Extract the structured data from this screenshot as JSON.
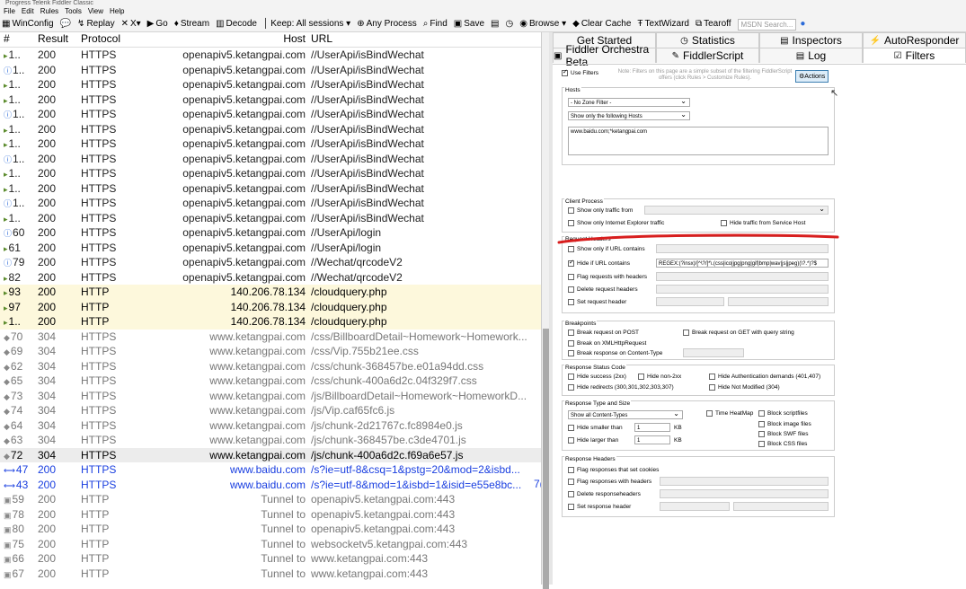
{
  "window": {
    "title": "Progress Telerik Fiddler Classic"
  },
  "menu": [
    "File",
    "Edit",
    "Rules",
    "Tools",
    "View",
    "Help"
  ],
  "toolbar": [
    {
      "icon": "winconfig-icon",
      "label": "WinConfig"
    },
    {
      "icon": "comment-icon",
      "label": ""
    },
    {
      "icon": "replay-icon",
      "label": "Replay"
    },
    {
      "icon": "remove-icon",
      "label": "X▾"
    },
    {
      "icon": "go-icon",
      "label": "Go"
    },
    {
      "icon": "stream-icon",
      "label": "Stream"
    },
    {
      "icon": "decode-icon",
      "label": "Decode"
    },
    {
      "icon": "keep-icon",
      "label": "Keep: All sessions ▾"
    },
    {
      "icon": "crosshair-icon",
      "label": "Any Process"
    },
    {
      "icon": "find-icon",
      "label": "Find"
    },
    {
      "icon": "save-icon",
      "label": "Save"
    },
    {
      "icon": "screenshot-icon",
      "label": ""
    },
    {
      "icon": "timer-icon",
      "label": ""
    },
    {
      "icon": "browse-icon",
      "label": "Browse ▾"
    },
    {
      "icon": "clear-cache-icon",
      "label": "Clear Cache"
    },
    {
      "icon": "textwizard-icon",
      "label": "TextWizard"
    },
    {
      "icon": "tearoff-icon",
      "label": "Tearoff"
    }
  ],
  "msdn_search": {
    "placeholder": "MSDN Search..."
  },
  "columns": {
    "num": "#",
    "result": "Result",
    "protocol": "Protocol",
    "host": "Host",
    "url": "URL"
  },
  "sessions": [
    {
      "num": "1..",
      "result": "200",
      "protocol": "HTTPS",
      "host": "openapiv5.ketangpai.com",
      "url": "//UserApi/isBindWechat",
      "style": "dark",
      "icon": "response-icon"
    },
    {
      "num": "1..",
      "result": "200",
      "protocol": "HTTPS",
      "host": "openapiv5.ketangpai.com",
      "url": "//UserApi/isBindWechat",
      "style": "dark",
      "icon": "info-icon"
    },
    {
      "num": "1..",
      "result": "200",
      "protocol": "HTTPS",
      "host": "openapiv5.ketangpai.com",
      "url": "//UserApi/isBindWechat",
      "style": "dark",
      "icon": "response-icon"
    },
    {
      "num": "1..",
      "result": "200",
      "protocol": "HTTPS",
      "host": "openapiv5.ketangpai.com",
      "url": "//UserApi/isBindWechat",
      "style": "dark",
      "icon": "response-icon"
    },
    {
      "num": "1..",
      "result": "200",
      "protocol": "HTTPS",
      "host": "openapiv5.ketangpai.com",
      "url": "//UserApi/isBindWechat",
      "style": "dark",
      "icon": "info-icon"
    },
    {
      "num": "1..",
      "result": "200",
      "protocol": "HTTPS",
      "host": "openapiv5.ketangpai.com",
      "url": "//UserApi/isBindWechat",
      "style": "dark",
      "icon": "response-icon"
    },
    {
      "num": "1..",
      "result": "200",
      "protocol": "HTTPS",
      "host": "openapiv5.ketangpai.com",
      "url": "//UserApi/isBindWechat",
      "style": "dark",
      "icon": "response-icon"
    },
    {
      "num": "1..",
      "result": "200",
      "protocol": "HTTPS",
      "host": "openapiv5.ketangpai.com",
      "url": "//UserApi/isBindWechat",
      "style": "dark",
      "icon": "info-icon"
    },
    {
      "num": "1..",
      "result": "200",
      "protocol": "HTTPS",
      "host": "openapiv5.ketangpai.com",
      "url": "//UserApi/isBindWechat",
      "style": "dark",
      "icon": "response-icon"
    },
    {
      "num": "1..",
      "result": "200",
      "protocol": "HTTPS",
      "host": "openapiv5.ketangpai.com",
      "url": "//UserApi/isBindWechat",
      "style": "dark",
      "icon": "response-icon"
    },
    {
      "num": "1..",
      "result": "200",
      "protocol": "HTTPS",
      "host": "openapiv5.ketangpai.com",
      "url": "//UserApi/isBindWechat",
      "style": "dark",
      "icon": "info-icon"
    },
    {
      "num": "1..",
      "result": "200",
      "protocol": "HTTPS",
      "host": "openapiv5.ketangpai.com",
      "url": "//UserApi/isBindWechat",
      "style": "dark",
      "icon": "response-icon"
    },
    {
      "num": "60",
      "result": "200",
      "protocol": "HTTPS",
      "host": "openapiv5.ketangpai.com",
      "url": "//UserApi/login",
      "style": "dark",
      "icon": "info-icon"
    },
    {
      "num": "61",
      "result": "200",
      "protocol": "HTTPS",
      "host": "openapiv5.ketangpai.com",
      "url": "//UserApi/login",
      "style": "dark",
      "icon": "response-icon"
    },
    {
      "num": "79",
      "result": "200",
      "protocol": "HTTPS",
      "host": "openapiv5.ketangpai.com",
      "url": "//Wechat/qrcodeV2",
      "style": "dark",
      "icon": "info-icon"
    },
    {
      "num": "82",
      "result": "200",
      "protocol": "HTTPS",
      "host": "openapiv5.ketangpai.com",
      "url": "//Wechat/qrcodeV2",
      "style": "dark",
      "icon": "response-icon"
    },
    {
      "num": "93",
      "result": "200",
      "protocol": "HTTP",
      "host": "140.206.78.134",
      "url": "/cloudquery.php",
      "style": "yellow",
      "icon": "response-icon"
    },
    {
      "num": "97",
      "result": "200",
      "protocol": "HTTP",
      "host": "140.206.78.134",
      "url": "/cloudquery.php",
      "style": "yellow",
      "icon": "response-icon"
    },
    {
      "num": "1..",
      "result": "200",
      "protocol": "HTTP",
      "host": "140.206.78.134",
      "url": "/cloudquery.php",
      "style": "yellow",
      "icon": "response-icon"
    },
    {
      "num": "70",
      "result": "304",
      "protocol": "HTTPS",
      "host": "www.ketangpai.com",
      "url": "/css/BillboardDetail~Homework~Homework...",
      "style": "grey",
      "icon": "cached-icon"
    },
    {
      "num": "69",
      "result": "304",
      "protocol": "HTTPS",
      "host": "www.ketangpai.com",
      "url": "/css/Vip.755b21ee.css",
      "style": "grey",
      "icon": "cached-icon"
    },
    {
      "num": "62",
      "result": "304",
      "protocol": "HTTPS",
      "host": "www.ketangpai.com",
      "url": "/css/chunk-368457be.e01a94dd.css",
      "style": "grey",
      "icon": "cached-icon"
    },
    {
      "num": "65",
      "result": "304",
      "protocol": "HTTPS",
      "host": "www.ketangpai.com",
      "url": "/css/chunk-400a6d2c.04f329f7.css",
      "style": "grey",
      "icon": "cached-icon"
    },
    {
      "num": "73",
      "result": "304",
      "protocol": "HTTPS",
      "host": "www.ketangpai.com",
      "url": "/js/BillboardDetail~Homework~HomeworkD...",
      "style": "grey",
      "icon": "cached-icon"
    },
    {
      "num": "74",
      "result": "304",
      "protocol": "HTTPS",
      "host": "www.ketangpai.com",
      "url": "/js/Vip.caf65fc6.js",
      "style": "grey",
      "icon": "cached-icon"
    },
    {
      "num": "64",
      "result": "304",
      "protocol": "HTTPS",
      "host": "www.ketangpai.com",
      "url": "/js/chunk-2d21767c.fc8984e0.js",
      "style": "grey",
      "icon": "cached-icon"
    },
    {
      "num": "63",
      "result": "304",
      "protocol": "HTTPS",
      "host": "www.ketangpai.com",
      "url": "/js/chunk-368457be.c3de4701.js",
      "style": "grey",
      "icon": "cached-icon"
    },
    {
      "num": "72",
      "result": "304",
      "protocol": "HTTPS",
      "host": "www.ketangpai.com",
      "url": "/js/chunk-400a6d2c.f69a6e57.js",
      "style": "selected",
      "icon": "cached-icon"
    },
    {
      "num": "47",
      "result": "200",
      "protocol": "HTTPS",
      "host": "www.baidu.com",
      "url": "/s?ie=utf-8&csq=1&pstg=20&mod=2&isbd...",
      "style": "blue",
      "icon": "json-icon"
    },
    {
      "num": "43",
      "result": "200",
      "protocol": "HTTPS",
      "host": "www.baidu.com",
      "url": "/s?ie=utf-8&mod=1&isbd=1&isid=e55e8bc...",
      "style": "blue",
      "icon": "json-icon"
    },
    {
      "num": "59",
      "result": "200",
      "protocol": "HTTP",
      "host": "Tunnel to",
      "url": "openapiv5.ketangpai.com:443",
      "style": "tunnel",
      "icon": "lock-icon"
    },
    {
      "num": "78",
      "result": "200",
      "protocol": "HTTP",
      "host": "Tunnel to",
      "url": "openapiv5.ketangpai.com:443",
      "style": "tunnel",
      "icon": "lock-icon"
    },
    {
      "num": "80",
      "result": "200",
      "protocol": "HTTP",
      "host": "Tunnel to",
      "url": "openapiv5.ketangpai.com:443",
      "style": "tunnel",
      "icon": "lock-icon"
    },
    {
      "num": "75",
      "result": "200",
      "protocol": "HTTP",
      "host": "Tunnel to",
      "url": "websocketv5.ketangpai.com:443",
      "style": "tunnel",
      "icon": "lock-icon"
    },
    {
      "num": "66",
      "result": "200",
      "protocol": "HTTP",
      "host": "Tunnel to",
      "url": "www.ketangpai.com:443",
      "style": "tunnel",
      "icon": "lock-icon"
    },
    {
      "num": "67",
      "result": "200",
      "protocol": "HTTP",
      "host": "Tunnel to",
      "url": "www.ketangpai.com:443",
      "style": "tunnel",
      "icon": "lock-icon"
    }
  ],
  "overflow_marker": "7(",
  "tabs_row1": [
    {
      "label": "Get Started",
      "icon": ""
    },
    {
      "label": "Statistics",
      "icon": "statistics-icon"
    },
    {
      "label": "Inspectors",
      "icon": "inspectors-icon"
    },
    {
      "label": "AutoResponder",
      "icon": "autoresponder-icon"
    }
  ],
  "tabs_row2": [
    {
      "label": "Fiddler Orchestra Beta",
      "icon": "orchestra-icon"
    },
    {
      "label": "FiddlerScript",
      "icon": "script-icon"
    },
    {
      "label": "Log",
      "icon": "log-icon"
    },
    {
      "label": "Filters",
      "icon": "filters-icon",
      "active": true
    }
  ],
  "filters": {
    "use_filters": "Use Filters",
    "note": "Note: Filters on this page are a simple subset of the filtering FiddlerScript offers (click Rules > Customize Rules).",
    "actions": "Actions",
    "hosts_title": "Hosts",
    "zone_filter": "- No Zone Filter -",
    "host_mode": "Show only the following Hosts",
    "host_list": "www.baidu.com;*ketangpai.com",
    "client_title": "Client Process",
    "show_traffic_from": "Show only traffic from",
    "ie_only": "Show only Internet Explorer traffic",
    "hide_service_host": "Hide traffic from Service Host",
    "reqh_title": "Request Headers",
    "show_if_url": "Show only if URL contains",
    "hide_if_url": "Hide if URL contains",
    "hide_if_url_value": "REGEX:(?insx)/[^\\?/]*\\.(css|ico|jpg|png|gif|bmp|wav|js|jpeg)(\\?.*)?$",
    "flag_headers": "Flag requests with headers",
    "delete_headers": "Delete request headers",
    "set_header": "Set request header",
    "bp_title": "Breakpoints",
    "bp_post": "Break request on POST",
    "bp_get": "Break request on GET with query string",
    "bp_xml": "Break on XMLHttpRequest",
    "bp_ct": "Break response on Content-Type",
    "rsc_title": "Response Status Code",
    "hide_success": "Hide success (2xx)",
    "hide_non2xx": "Hide non-2xx",
    "hide_auth": "Hide Authentication demands (401,407)",
    "hide_redirects": "Hide redirects (300,301,302,303,307)",
    "hide_304": "Hide Not Modified (304)",
    "rts_title": "Response Type and Size",
    "content_types": "Show all Content-Types",
    "time_heatmap": "Time HeatMap",
    "block_script": "Block scriptfiles",
    "block_image": "Block image files",
    "block_swf": "Block SWF files",
    "block_css": "Block CSS files",
    "hide_smaller": "Hide smaller than",
    "hide_larger": "Hide larger than",
    "size_value": "1",
    "kb": "KB",
    "rh_title": "Response Headers",
    "flag_cookies": "Flag responses that set cookies",
    "flag_resp_headers": "Flag responses with headers",
    "delete_resp_headers": "Delete responseheaders",
    "set_resp_header": "Set response header"
  },
  "colors": {
    "annotation_red": "#d81e1e",
    "yellow_row": "#fdf8dc",
    "blue_text": "#1a3fe0"
  }
}
